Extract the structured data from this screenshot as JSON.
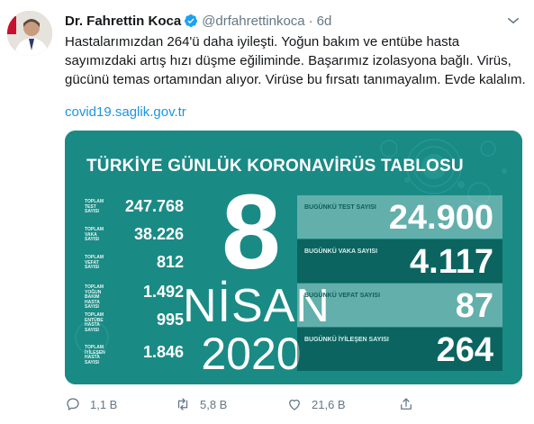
{
  "author": {
    "name": "Dr. Fahrettin Koca",
    "handle": "@drfahrettinkoca",
    "time": "6d",
    "separator": "·"
  },
  "tweet": {
    "text": "Hastalarımızdan 264'ü daha iyileşti. Yoğun bakım ve entübe hasta sayımızdaki artış hızı düşme eğiliminde. Başarımız izolasyona bağlı. Virüs, gücünü temas ortamından alıyor. Virüse bu fırsatı tanımayalım. Evde kalalım.",
    "link": "covid19.saglik.gov.tr"
  },
  "card": {
    "title": "TÜRKİYE GÜNLÜK KORONAVİRÜS TABLOSU",
    "day": "8",
    "month": "NİSAN",
    "year": "2020",
    "totals": [
      {
        "label": "TOPLAM TEST SAYISI",
        "value": "247.768"
      },
      {
        "label": "TOPLAM VAKA SAYISI",
        "value": "38.226"
      },
      {
        "label": "TOPLAM VEFAT SAYISI",
        "value": "812"
      },
      {
        "label": "TOPLAM YOĞUN BAKIM HASTA SAYISI",
        "value": "1.492"
      },
      {
        "label": "TOPLAM ENTÜBE HASTA SAYISI",
        "value": "995"
      },
      {
        "label": "TOPLAM İYİLEŞEN HASTA SAYISI",
        "value": "1.846"
      }
    ],
    "today": [
      {
        "label": "BUGÜNKÜ TEST SAYISI",
        "value": "24.900"
      },
      {
        "label": "BUGÜNKÜ VAKA SAYISI",
        "value": "4.117"
      },
      {
        "label": "BUGÜNKÜ VEFAT SAYISI",
        "value": "87"
      },
      {
        "label": "BUGÜNKÜ İYİLEŞEN SAYISI",
        "value": "264"
      }
    ]
  },
  "actions": {
    "reply_count": "1,1 B",
    "retweet_count": "5,8 B",
    "like_count": "21,6 B"
  },
  "icons": {
    "verified": "verified-badge-icon",
    "caret": "chevron-down-icon",
    "reply": "reply-icon",
    "retweet": "retweet-icon",
    "like": "heart-icon",
    "share": "share-icon"
  },
  "colors": {
    "accent": "#1da1f2",
    "link": "#1b95e0",
    "muted": "#657786",
    "card_bg": "#1a8a85"
  }
}
